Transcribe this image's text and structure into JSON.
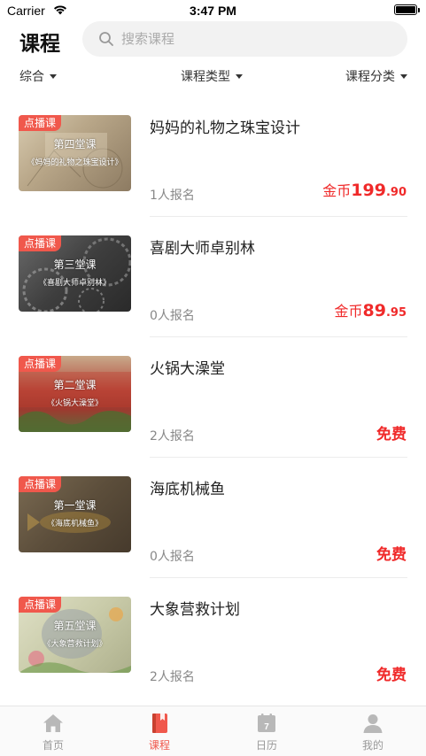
{
  "status_bar": {
    "carrier": "Carrier",
    "time": "3:47 PM"
  },
  "header": {
    "title": "课程",
    "search_placeholder": "搜索课程"
  },
  "filters": [
    {
      "label": "综合"
    },
    {
      "label": "课程类型"
    },
    {
      "label": "课程分类"
    }
  ],
  "courses": [
    {
      "badge": "点播课",
      "thumb_line1": "第四堂课",
      "thumb_line2": "《妈妈的礼物之珠宝设计》",
      "title": "妈妈的礼物之珠宝设计",
      "enrolled": "1人报名",
      "price_currency": "金币",
      "price_int": "199",
      "price_dec": ".90",
      "free_label": ""
    },
    {
      "badge": "点播课",
      "thumb_line1": "第三堂课",
      "thumb_line2": "《喜剧大师卓别林》",
      "title": "喜剧大师卓别林",
      "enrolled": "0人报名",
      "price_currency": "金币",
      "price_int": "89",
      "price_dec": ".95",
      "free_label": ""
    },
    {
      "badge": "点播课",
      "thumb_line1": "第二堂课",
      "thumb_line2": "《火锅大澡堂》",
      "title": "火锅大澡堂",
      "enrolled": "2人报名",
      "price_currency": "",
      "price_int": "",
      "price_dec": "",
      "free_label": "免费"
    },
    {
      "badge": "点播课",
      "thumb_line1": "第一堂课",
      "thumb_line2": "《海底机械鱼》",
      "title": "海底机械鱼",
      "enrolled": "0人报名",
      "price_currency": "",
      "price_int": "",
      "price_dec": "",
      "free_label": "免费"
    },
    {
      "badge": "点播课",
      "thumb_line1": "第五堂课",
      "thumb_line2": "《大象营救计划》",
      "title": "大象营救计划",
      "enrolled": "2人报名",
      "price_currency": "",
      "price_int": "",
      "price_dec": "",
      "free_label": "免费"
    }
  ],
  "tabbar": {
    "items": [
      {
        "label": "首页",
        "icon": "home-icon"
      },
      {
        "label": "课程",
        "icon": "book-icon",
        "active": true
      },
      {
        "label": "日历",
        "icon": "calendar-icon",
        "calendar_day": "7"
      },
      {
        "label": "我的",
        "icon": "person-icon"
      }
    ]
  },
  "colors": {
    "accent": "#f0584c",
    "price": "#f02a2a",
    "muted": "#888888"
  }
}
